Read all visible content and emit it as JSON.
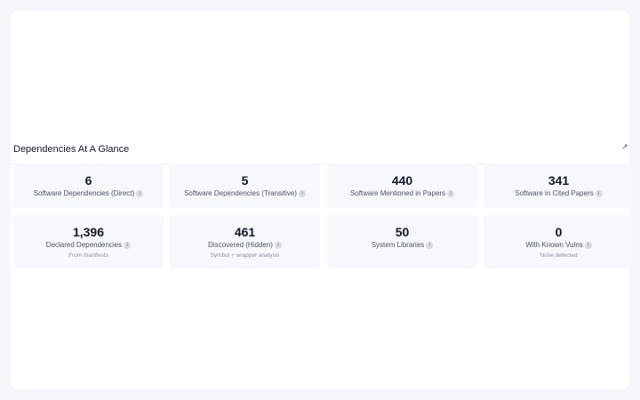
{
  "section": {
    "title": "Dependencies At A Glance"
  },
  "cards": [
    {
      "value": "6",
      "label": "Software Dependencies (Direct)",
      "sub": ""
    },
    {
      "value": "5",
      "label": "Software Dependencies (Transitive)",
      "sub": ""
    },
    {
      "value": "440",
      "label": "Software Mentioned in Papers",
      "sub": ""
    },
    {
      "value": "341",
      "label": "Software in Cited Papers",
      "sub": ""
    },
    {
      "value": "1,396",
      "label": "Declared Dependencies",
      "sub": "From manifests"
    },
    {
      "value": "461",
      "label": "Discovered (Hidden)",
      "sub": "Symbol + wrapper analysis"
    },
    {
      "value": "50",
      "label": "System Libraries",
      "sub": ""
    },
    {
      "value": "0",
      "label": "With Known Vulns",
      "sub": "None detected"
    }
  ],
  "icons": {
    "info": "info-icon",
    "expand": "expand-icon"
  },
  "info_glyph": "i"
}
